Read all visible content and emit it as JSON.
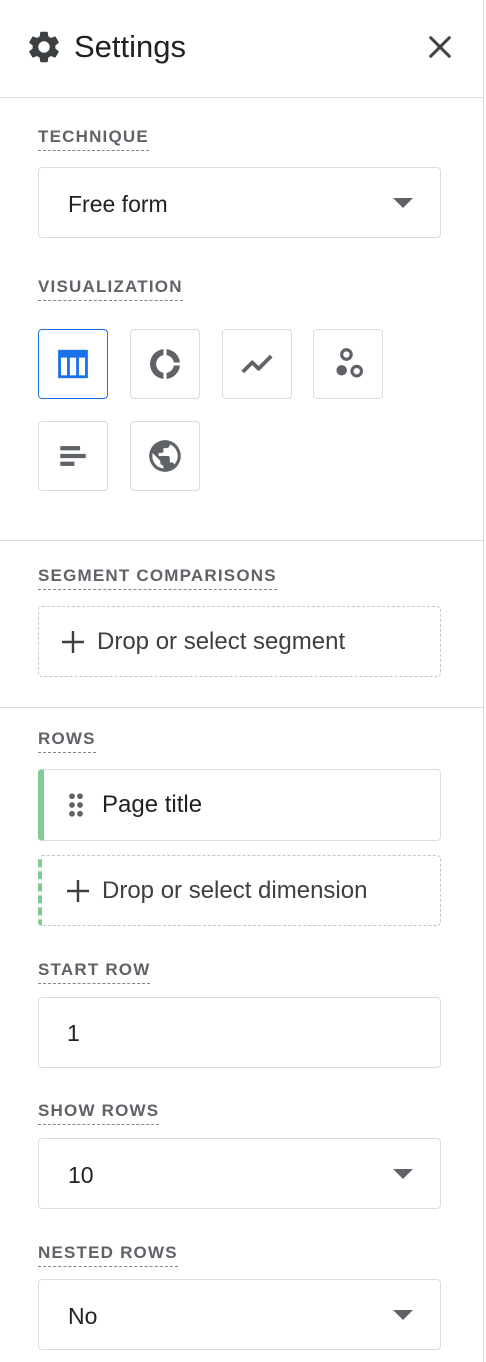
{
  "header": {
    "title": "Settings",
    "settings_icon": "gear-icon",
    "close_icon": "close-icon"
  },
  "technique": {
    "label": "TECHNIQUE",
    "value": "Free form"
  },
  "visualization": {
    "label": "VISUALIZATION",
    "options": [
      {
        "icon": "table-icon",
        "selected": true
      },
      {
        "icon": "donut-chart-icon",
        "selected": false
      },
      {
        "icon": "line-chart-icon",
        "selected": false
      },
      {
        "icon": "scatter-plot-icon",
        "selected": false
      },
      {
        "icon": "bar-chart-icon",
        "selected": false
      },
      {
        "icon": "globe-icon",
        "selected": false
      }
    ],
    "accent_color": "#1a73e8"
  },
  "segment_comparisons": {
    "label": "SEGMENT COMPARISONS",
    "drop_text": "Drop or select segment"
  },
  "rows": {
    "label": "ROWS",
    "items": [
      {
        "label": "Page title"
      }
    ],
    "drop_text": "Drop or select dimension",
    "accent_color": "#81c995"
  },
  "start_row": {
    "label": "START ROW",
    "value": "1"
  },
  "show_rows": {
    "label": "SHOW ROWS",
    "value": "10"
  },
  "nested_rows": {
    "label": "NESTED ROWS",
    "value": "No"
  }
}
